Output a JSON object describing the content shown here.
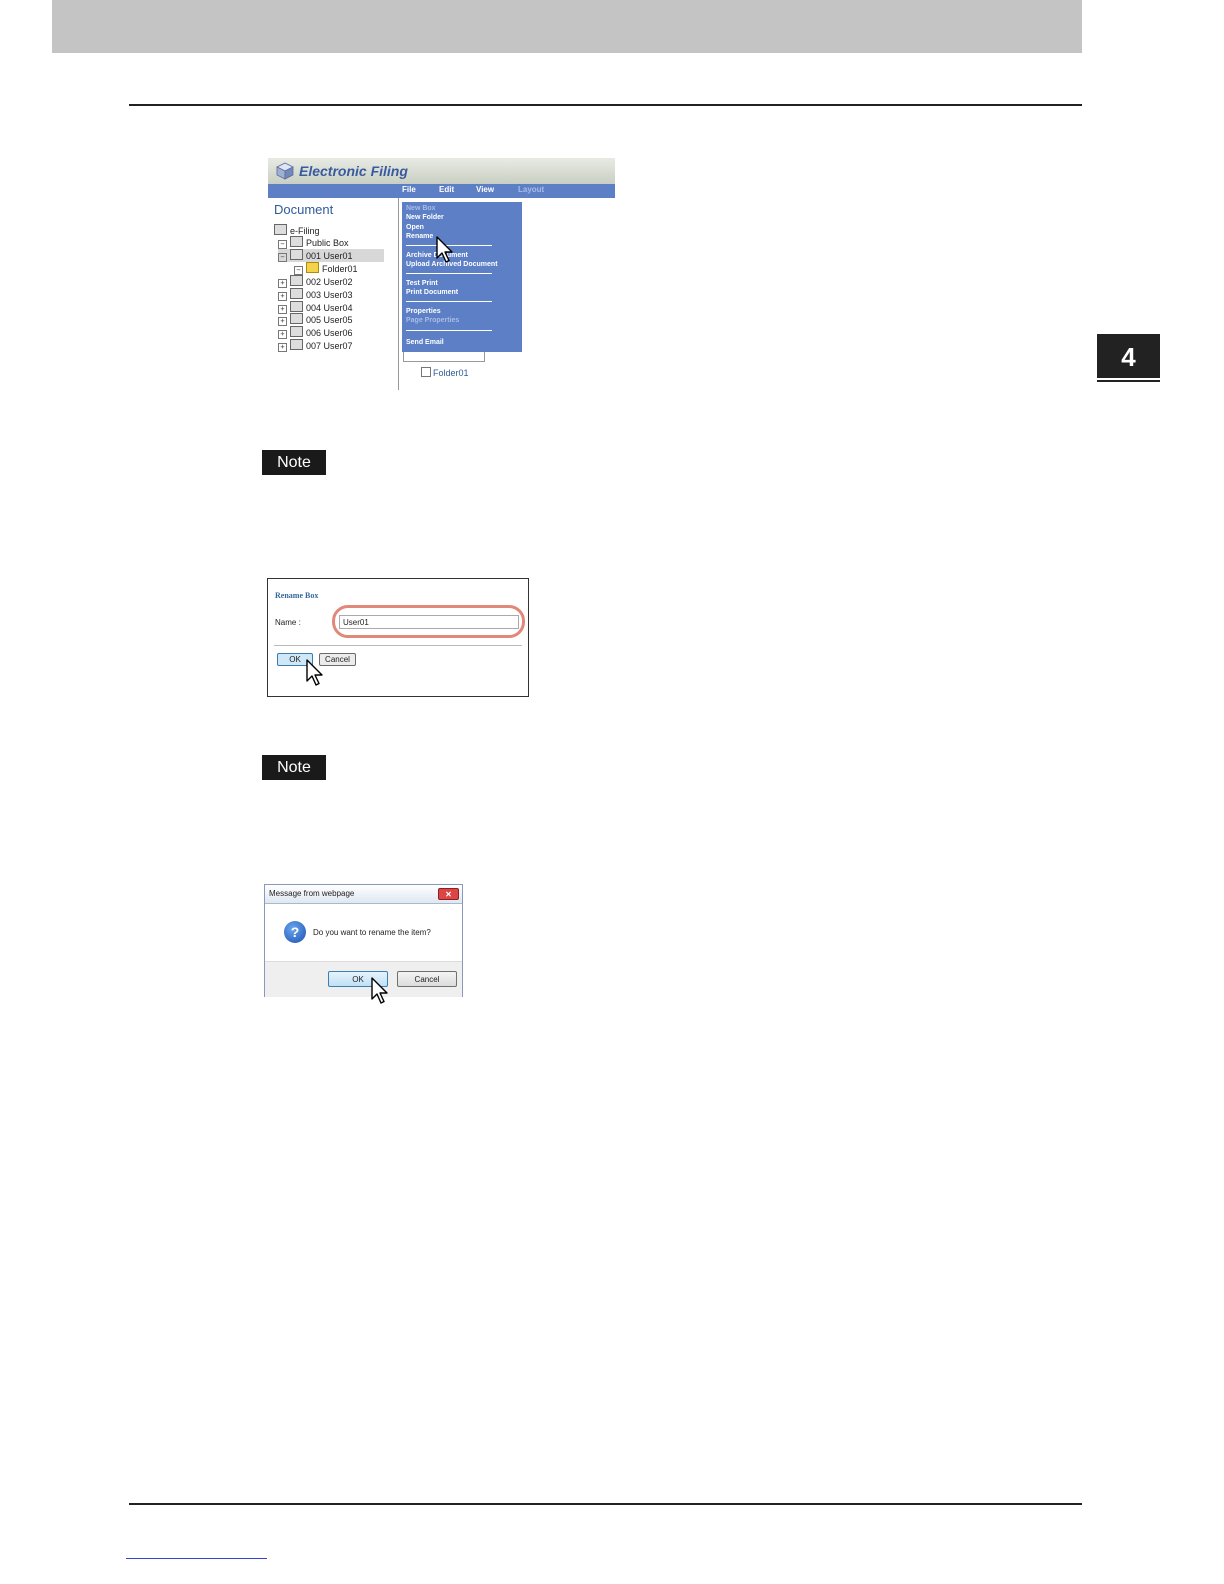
{
  "chapter": {
    "number": "4"
  },
  "notes": {
    "label": "Note"
  },
  "electronic_filing": {
    "app_title": "Electronic Filing",
    "menu": [
      "File",
      "Edit",
      "View",
      "Layout"
    ],
    "panel_title": "Document",
    "tree": {
      "root": "e-Filing",
      "public_box": "Public Box",
      "user01": "001 User01",
      "folder01": "Folder01",
      "user02": "002 User02",
      "user03": "003 User03",
      "user04": "004 User04",
      "user05": "005 User05",
      "user06": "006 User06",
      "user07": "007 User07"
    },
    "dropdown": {
      "new_box": "New Box",
      "new_folder": "New Folder",
      "open": "Open",
      "rename": "Rename",
      "archive_document": "Archive Document",
      "upload_archived_document": "Upload Archived Document",
      "test_print": "Test Print",
      "print_document": "Print Document",
      "properties": "Properties",
      "page_properties": "Page Properties",
      "send_email": "Send Email"
    },
    "content_folder": "Folder01"
  },
  "rename_box": {
    "title": "Rename Box",
    "name_label": "Name :",
    "name_value": "User01",
    "ok": "OK",
    "cancel": "Cancel"
  },
  "message_dialog": {
    "title": "Message from webpage",
    "message": "Do you want to rename the item?",
    "ok": "OK",
    "cancel": "Cancel",
    "close_glyph": "✕"
  }
}
